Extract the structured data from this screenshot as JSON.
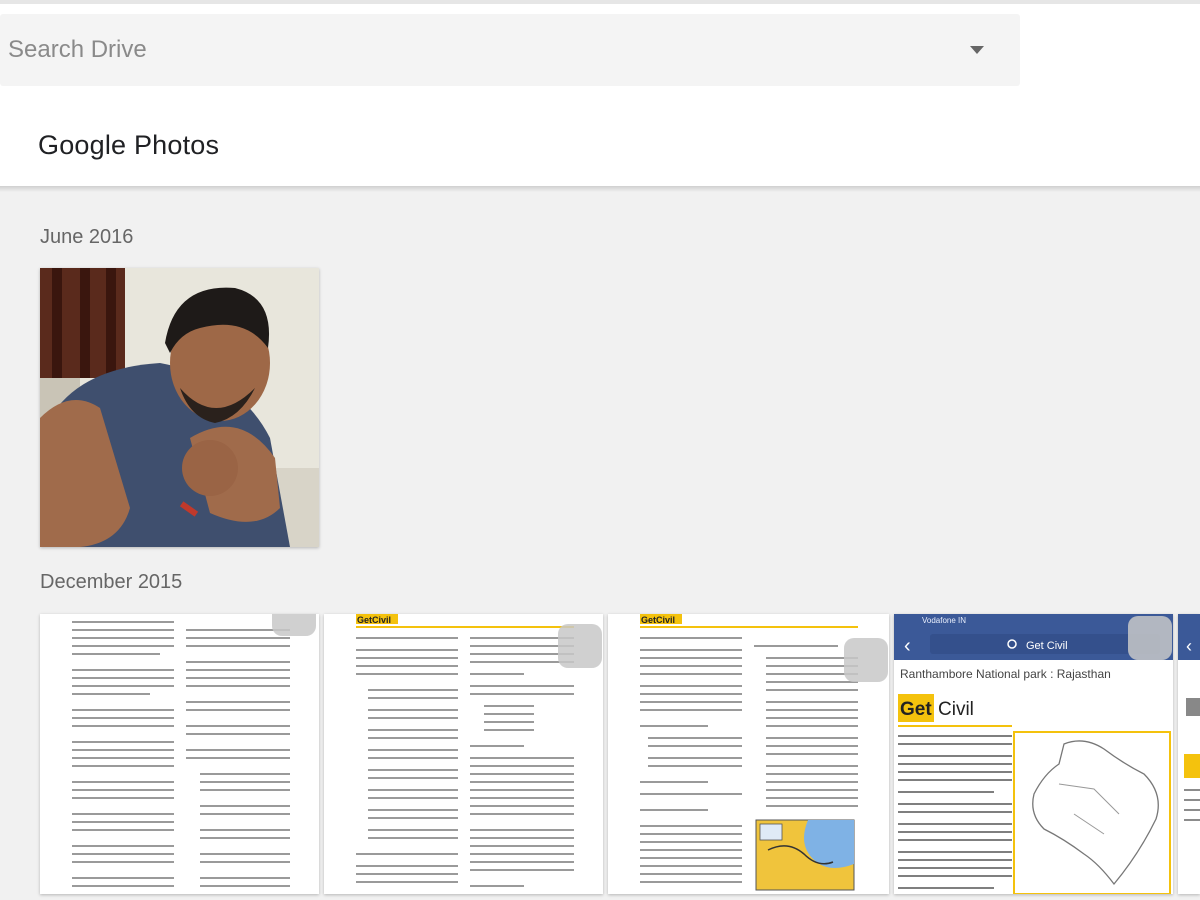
{
  "search": {
    "placeholder": "Search Drive"
  },
  "header": {
    "title": "Google Photos"
  },
  "sections": [
    {
      "label": "June 2016"
    },
    {
      "label": "December 2015"
    }
  ],
  "icons": {
    "dropdown": "arrow-drop-down-icon"
  },
  "thumbnails": {
    "doc2_logo": "GetCivil",
    "doc3_logo": "GetCivil",
    "phone": {
      "status": "Vodafone IN",
      "search": "Get Civil",
      "caption": "Ranthambore National park : Rajasthan",
      "logo_get": "Get",
      "logo_civil": "Civil"
    }
  },
  "colors": {
    "accent_yellow": "#f4c20d",
    "fb_blue": "#3b5998"
  }
}
